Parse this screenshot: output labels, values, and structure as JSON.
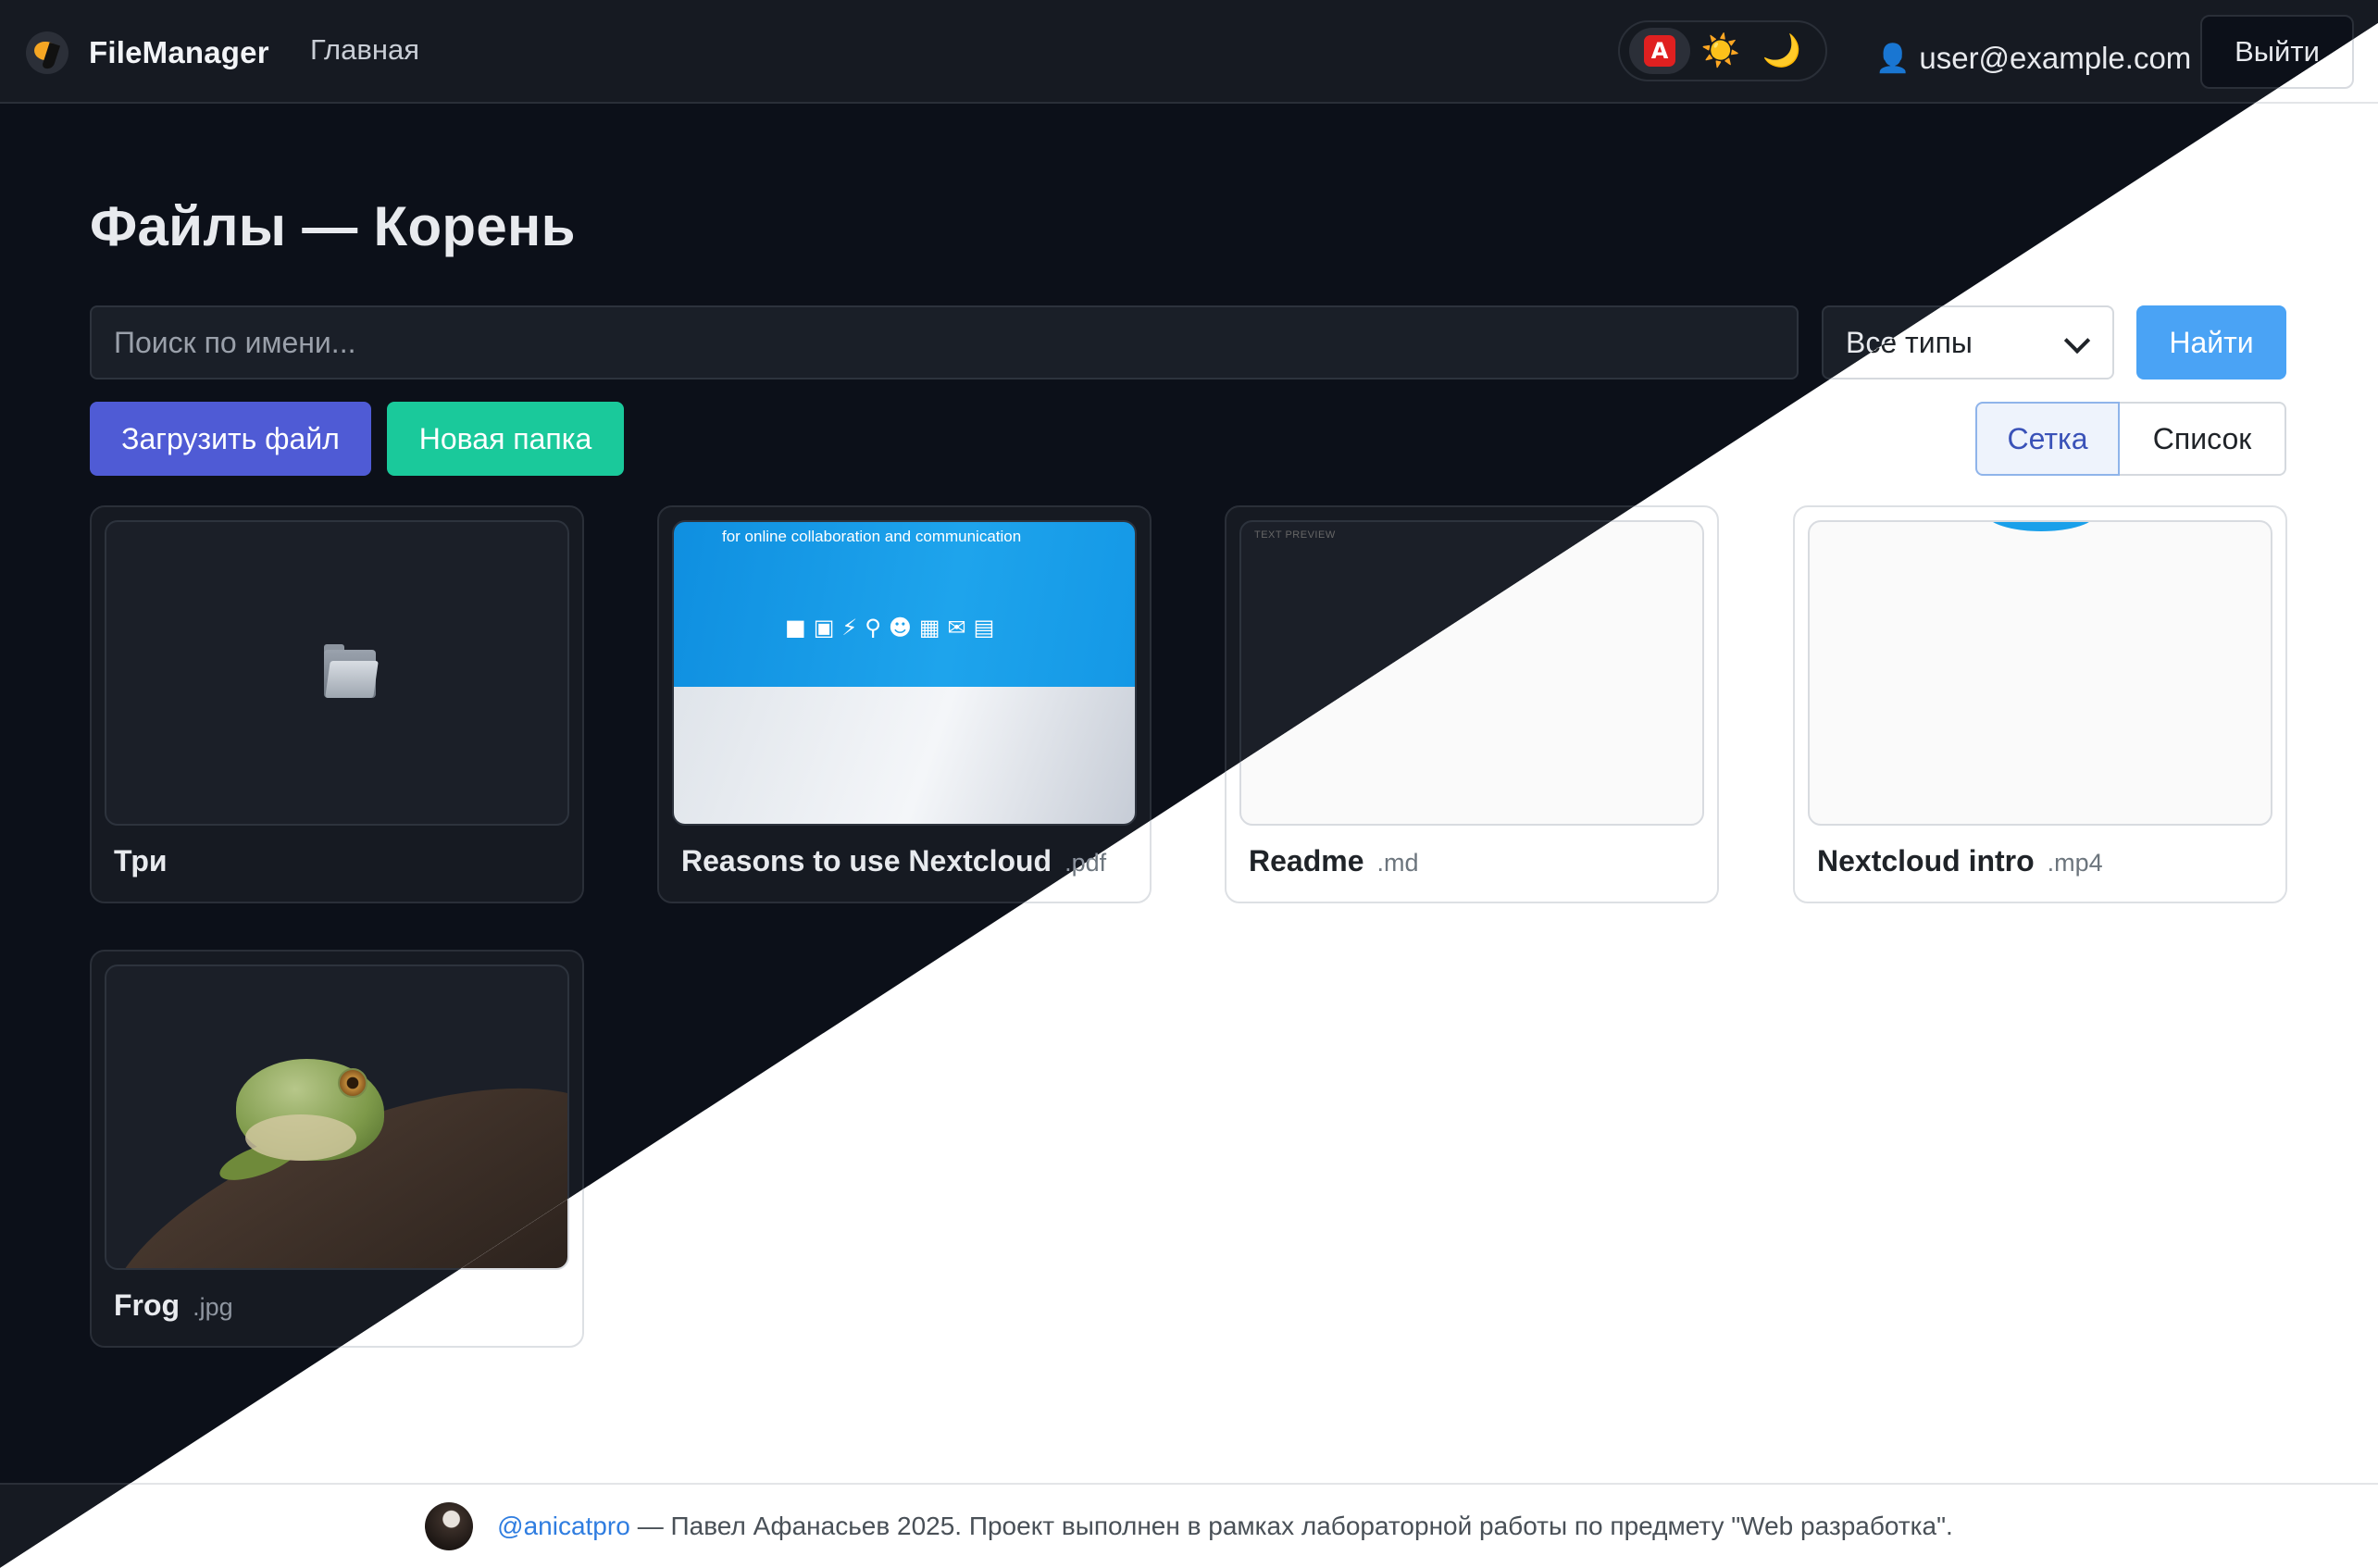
{
  "navbar": {
    "brand": "FileManager",
    "home_link": "Главная",
    "theme_toggle": {
      "auto_icon": "🅰",
      "light_icon": "☀️",
      "dark_icon": "🌙",
      "active": "auto"
    },
    "user_email": "user@example.com",
    "logout_label": "Выйти"
  },
  "page": {
    "title": "Файлы — Корень"
  },
  "search": {
    "placeholder": "Поиск по имени...",
    "value": "",
    "type_filter": "Все типы",
    "submit_label": "Найти"
  },
  "actions": {
    "upload_label": "Загрузить файл",
    "new_folder_label": "Новая папка"
  },
  "view_toggle": {
    "grid_label": "Сетка",
    "list_label": "Список",
    "active": "grid"
  },
  "files": [
    {
      "name": "Три",
      "ext": "",
      "type": "folder",
      "icon": "folder-icon"
    },
    {
      "name": "Reasons to use Nextcloud",
      "ext": ".pdf",
      "type": "pdf",
      "preview_text": "for online collaboration and communication"
    },
    {
      "name": "Readme",
      "ext": ".md",
      "type": "text",
      "preview_label": "TEXT PREVIEW"
    },
    {
      "name": "Nextcloud intro",
      "ext": ".mp4",
      "type": "video"
    },
    {
      "name": "Frog",
      "ext": ".jpg",
      "type": "image"
    }
  ],
  "footer": {
    "author_link": "@anicatpro",
    "text": "— Павел Афанасьев 2025. Проект выполнен в рамках лабораторной работы по предмету \"Web разработка\"."
  },
  "colors": {
    "dark_background": "#0c1019",
    "light_background": "#ffffff",
    "primary_upload": "#4f5bd5",
    "new_folder": "#1ac99b",
    "find_button": "#4aa3f5",
    "link": "#2f7de0"
  }
}
